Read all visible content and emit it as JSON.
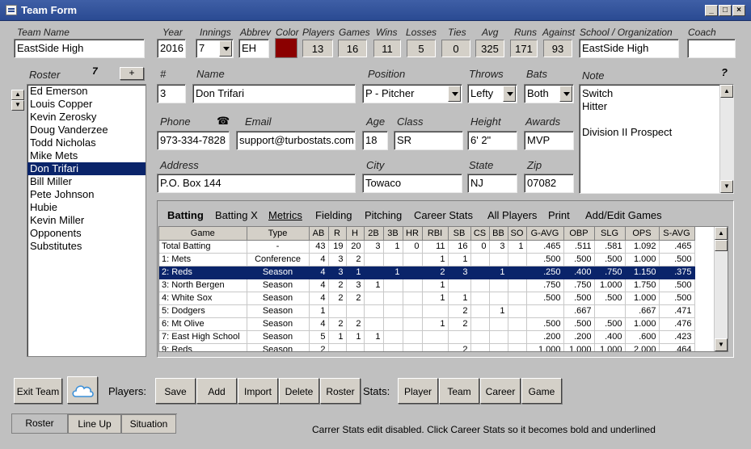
{
  "window": {
    "title": "Team Form"
  },
  "team": {
    "name_label": "Team Name",
    "name": "EastSide High",
    "year_label": "Year",
    "year": "2016",
    "innings_label": "Innings",
    "innings": "7",
    "abbrev_label": "Abbrev",
    "abbrev": "EH",
    "color_label": "Color",
    "color": "#8b0000",
    "players_label": "Players",
    "players": "13",
    "games_label": "Games",
    "games": "16",
    "wins_label": "Wins",
    "wins": "11",
    "losses_label": "Losses",
    "losses": "5",
    "ties_label": "Ties",
    "ties": "0",
    "avg_label": "Avg",
    "avg": "325",
    "runs_label": "Runs",
    "runs": "171",
    "against_label": "Against",
    "against": "93",
    "school_label": "School / Organization",
    "school": "EastSide High",
    "coach_label": "Coach",
    "coach": ""
  },
  "roster": {
    "label": "Roster",
    "count": "7",
    "add": "+",
    "items": [
      "Ed Emerson",
      "Louis Copper",
      "Kevin Zerosky",
      "Doug Vanderzee",
      "Todd Nicholas",
      "Mike Mets",
      "Don Trifari",
      "Bill Miller",
      "Pete Johnson",
      "Hubie",
      "Kevin Miller",
      "Opponents",
      "Substitutes"
    ],
    "selected": "Don Trifari"
  },
  "player": {
    "num_label": "#",
    "num": "3",
    "name_label": "Name",
    "name": "Don Trifari",
    "position_label": "Position",
    "position": "P - Pitcher",
    "throws_label": "Throws",
    "throws": "Lefty",
    "bats_label": "Bats",
    "bats": "Both",
    "note_label": "Note",
    "note_help": "?",
    "note_lines": [
      "Switch",
      "Hitter",
      "",
      "Division II Prospect"
    ],
    "phone_label": "Phone",
    "phone": "973-334-7828",
    "email_label": "Email",
    "email": "support@turbostats.com",
    "age_label": "Age",
    "age": "18",
    "class_label": "Class",
    "class": "SR",
    "height_label": "Height",
    "height": "6' 2\"",
    "awards_label": "Awards",
    "awards": "MVP",
    "address_label": "Address",
    "address": "P.O. Box 144",
    "city_label": "City",
    "city": "Towaco",
    "state_label": "State",
    "state": "NJ",
    "zip_label": "Zip",
    "zip": "07082"
  },
  "stats_tabs": [
    "Batting",
    "Batting X",
    "Metrics",
    "Fielding",
    "Pitching",
    "Career Stats",
    "All Players",
    "Print",
    "Add/Edit Games"
  ],
  "grid": {
    "headers": [
      "Game",
      "Type",
      "AB",
      "R",
      "H",
      "2B",
      "3B",
      "HR",
      "RBI",
      "SB",
      "CS",
      "BB",
      "SO",
      "G-AVG",
      "OBP",
      "SLG",
      "OPS",
      "S-AVG"
    ],
    "rows": [
      [
        "Total Batting",
        "-",
        "43",
        "19",
        "20",
        "3",
        "1",
        "0",
        "11",
        "16",
        "0",
        "3",
        "1",
        ".465",
        ".511",
        ".581",
        "1.092",
        ".465"
      ],
      [
        "1: Mets",
        "Conference",
        "4",
        "3",
        "2",
        "",
        "",
        "",
        "1",
        "1",
        "",
        "",
        "",
        ".500",
        ".500",
        ".500",
        "1.000",
        ".500"
      ],
      [
        "2: Reds",
        "Season",
        "4",
        "3",
        "1",
        "",
        "1",
        "",
        "2",
        "3",
        "",
        "1",
        "",
        ".250",
        ".400",
        ".750",
        "1.150",
        ".375"
      ],
      [
        "3: North Bergen",
        "Season",
        "4",
        "2",
        "3",
        "1",
        "",
        "",
        "1",
        "",
        "",
        "",
        "",
        ".750",
        ".750",
        "1.000",
        "1.750",
        ".500"
      ],
      [
        "4: White Sox",
        "Season",
        "4",
        "2",
        "2",
        "",
        "",
        "",
        "1",
        "1",
        "",
        "",
        "",
        ".500",
        ".500",
        ".500",
        "1.000",
        ".500"
      ],
      [
        "5: Dodgers",
        "Season",
        "1",
        "",
        "",
        "",
        "",
        "",
        "",
        "2",
        "",
        "1",
        "",
        "",
        ".667",
        "",
        ".667",
        ".471"
      ],
      [
        "6: Mt Olive",
        "Season",
        "4",
        "2",
        "2",
        "",
        "",
        "",
        "1",
        "2",
        "",
        "",
        "",
        ".500",
        ".500",
        ".500",
        "1.000",
        ".476"
      ],
      [
        "7: East High School",
        "Season",
        "5",
        "1",
        "1",
        "1",
        "",
        "",
        "",
        "",
        "",
        "",
        "",
        ".200",
        ".200",
        ".400",
        ".600",
        ".423"
      ],
      [
        "9: Reds",
        "Season",
        "2",
        "",
        "",
        "",
        "",
        "",
        "",
        "2",
        "",
        "",
        "",
        "1.000",
        "1.000",
        "1.000",
        "2.000",
        ".464"
      ]
    ],
    "selected_row": 2
  },
  "buttons": {
    "exit": "Exit Team",
    "players_label": "Players:",
    "save": "Save",
    "add": "Add",
    "import": "Import",
    "delete": "Delete",
    "roster": "Roster",
    "stats_label": "Stats:",
    "player": "Player",
    "team": "Team",
    "career": "Career",
    "game": "Game"
  },
  "bottom_tabs": [
    "Roster",
    "Line Up",
    "Situation"
  ],
  "status": "Carrer Stats edit disabled.  Click Career Stats so it becomes bold and underlined"
}
